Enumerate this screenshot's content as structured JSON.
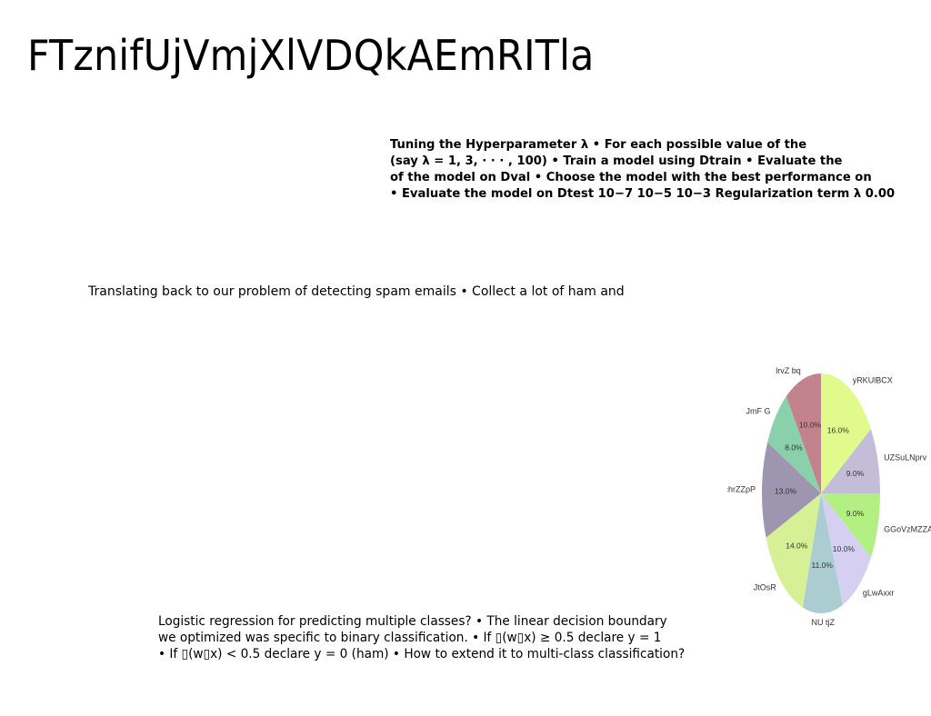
{
  "title": "FTznifUjVmjXlVDQkAEmRITla",
  "hyperparam_block": {
    "lines": [
      "Tuning the Hyperparameter λ • For each possible value of the",
      "(say λ = 1, 3, · · · , 100) • Train a model using Dtrain • Evaluate the",
      "of the model on Dval • Choose the model with the best performance on",
      "• Evaluate the model on Dtest 10−7 10−5 10−3 Regularization term λ 0.00"
    ]
  },
  "spam_paragraph": "Translating back to our problem of detecting spam emails • Collect a lot of ham and",
  "logistic_paragraph": {
    "lines": [
      "Logistic regression for predicting multiple classes? • The linear decision boundary",
      "we optimized was specific to binary classification. • If ▯(w▯x) ≥ 0.5 declare y = 1",
      "• If ▯(w▯x) < 0.5 declare y = 0 (ham) • How to extend it to multi-class classification?"
    ]
  },
  "chart_data": {
    "type": "pie",
    "start_angle_deg": 90,
    "direction": "clockwise",
    "slices": [
      {
        "label": "yRKUlBCX",
        "value": 16.0,
        "pct_label": "16.0%",
        "color": "#e0fb8b"
      },
      {
        "label": "UZSuLNprv",
        "value": 9.0,
        "pct_label": "9.0%",
        "color": "#c3bdd8"
      },
      {
        "label": "GGoVzMZZAu",
        "value": 9.0,
        "pct_label": "9.0%",
        "color": "#b4ef84"
      },
      {
        "label": "gLwAxxr",
        "value": 10.0,
        "pct_label": "10.0%",
        "color": "#d5d0f2"
      },
      {
        "label": "NU tjZ",
        "value": 11.0,
        "pct_label": "11.0%",
        "color": "#abcdd2"
      },
      {
        "label": "JtOsR",
        "value": 14.0,
        "pct_label": "14.0%",
        "color": "#d5f095"
      },
      {
        "label": "chrZZpP",
        "value": 13.0,
        "pct_label": "13.0%",
        "color": "#9e95b0"
      },
      {
        "label": "JmF G",
        "value": 8.0,
        "pct_label": "8.0%",
        "color": "#88d1aa"
      },
      {
        "label": "lrvZ bq",
        "value": 10.0,
        "pct_label": "10.0%",
        "color": "#c2828e"
      }
    ]
  }
}
